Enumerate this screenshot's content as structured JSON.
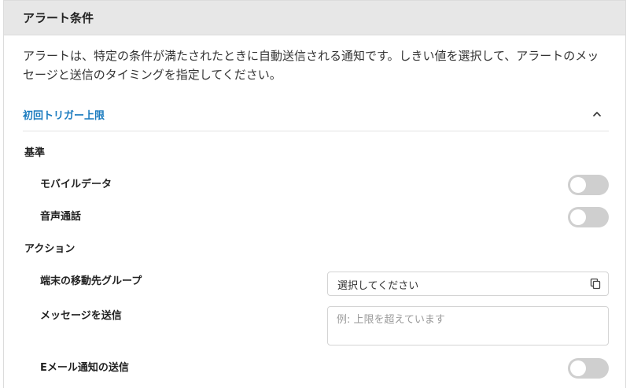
{
  "panel": {
    "title": "アラート条件",
    "description": "アラートは、特定の条件が満たされたときに自動送信される通知です。しきい値を選択して、アラートのメッセージと送信のタイミングを指定してください。"
  },
  "section": {
    "title": "初回トリガー上限",
    "collapse_icon": "chevron-up-icon",
    "expanded": true
  },
  "criteria": {
    "label": "基準",
    "items": [
      {
        "label": "モバイルデータ",
        "enabled": false
      },
      {
        "label": "音声通話",
        "enabled": false
      }
    ]
  },
  "actions": {
    "label": "アクション",
    "move_group": {
      "label": "端末の移動先グループ",
      "value": "選択してください",
      "icon": "copy-icon"
    },
    "send_message": {
      "label": "メッセージを送信",
      "placeholder": "例: 上限を超えています",
      "value": ""
    },
    "send_email": {
      "label": "Eメール通知の送信",
      "enabled": false
    }
  },
  "colors": {
    "header_bg": "#e7e7e7",
    "accent": "#1a7bbf",
    "toggle_off": "#cfcfcf"
  }
}
